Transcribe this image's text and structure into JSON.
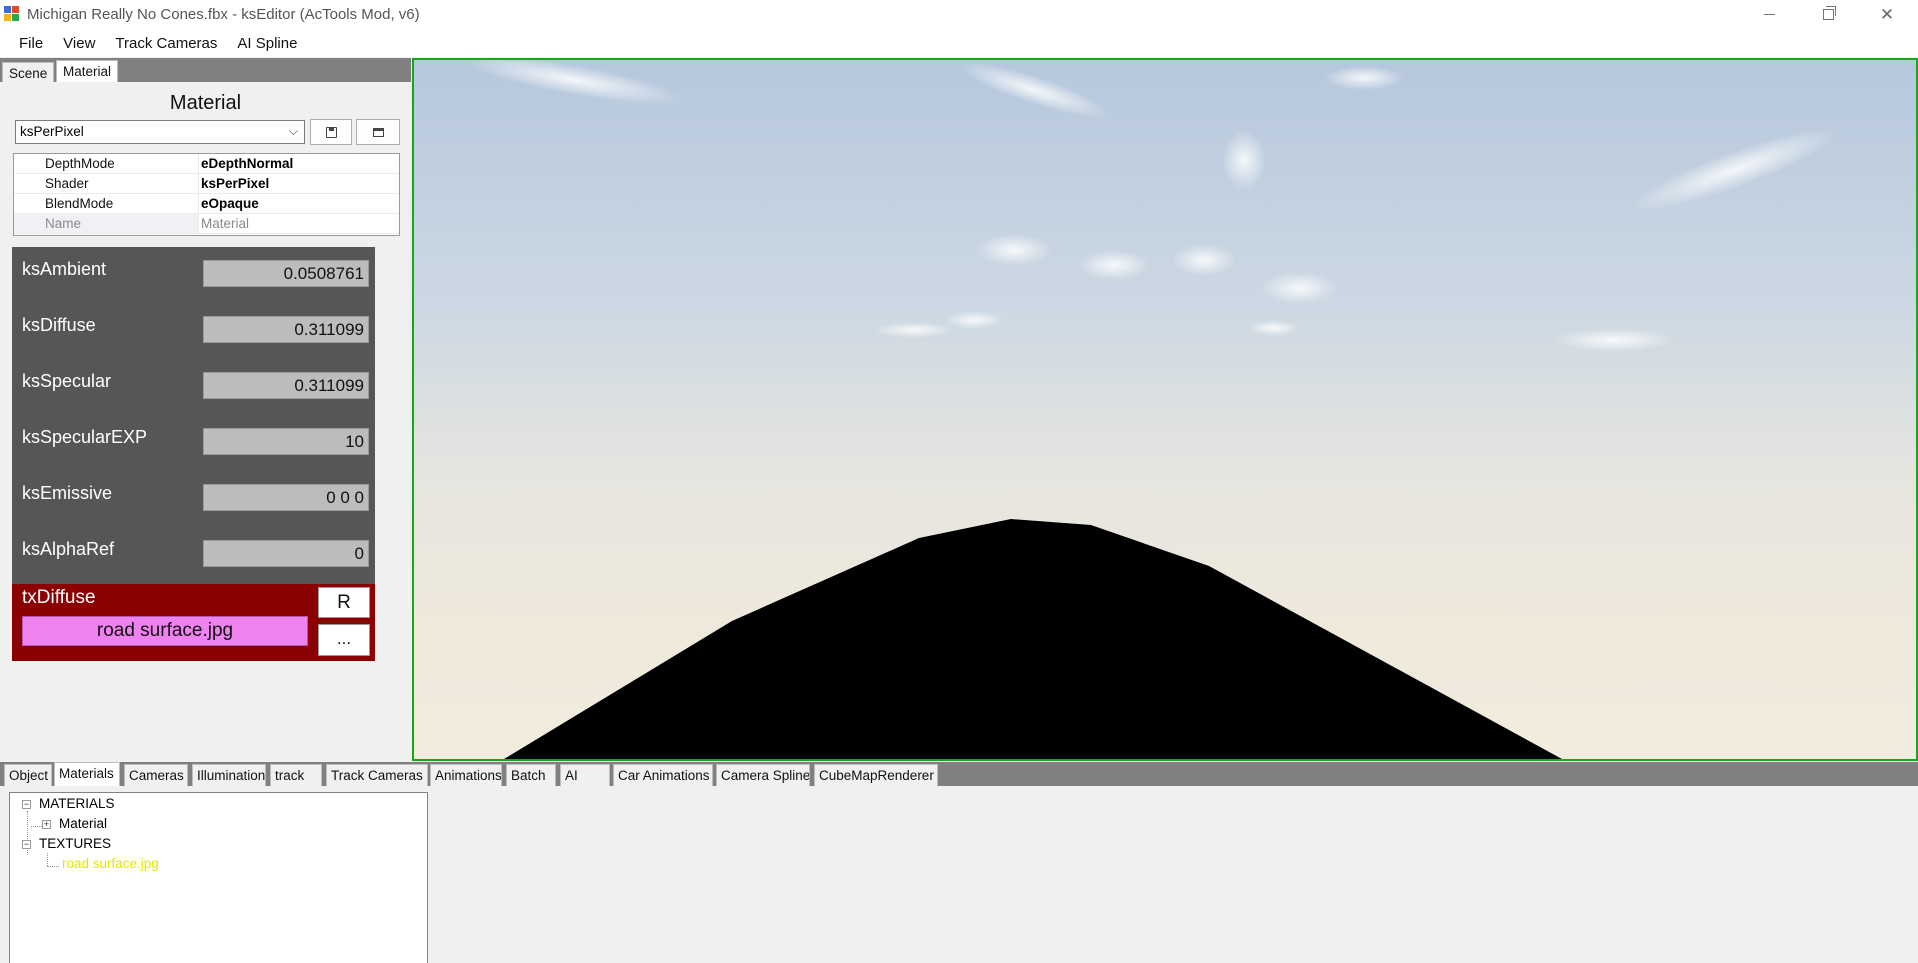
{
  "window": {
    "title": "Michigan Really No Cones.fbx - ksEditor (AcTools Mod, v6)"
  },
  "window_controls": {
    "minimize_icon": "minimize-icon",
    "restore_icon": "restore-icon",
    "close_icon": "close-icon",
    "close_glyph": "✕"
  },
  "menu": {
    "items": [
      "File",
      "View",
      "Track Cameras",
      "AI Spline"
    ]
  },
  "left_tabs": [
    "Scene",
    "Material"
  ],
  "left_active_tab": "Material",
  "material_panel": {
    "heading": "Material",
    "shader_select_value": "ksPerPixel",
    "chevron": "⌵",
    "properties": [
      {
        "name": "DepthMode",
        "value": "eDepthNormal"
      },
      {
        "name": "Shader",
        "value": "ksPerPixel"
      },
      {
        "name": "BlendMode",
        "value": "eOpaque"
      },
      {
        "name": "Name",
        "value": "Material"
      }
    ],
    "parameters": [
      {
        "name": "ksAmbient",
        "value": "0.0508761"
      },
      {
        "name": "ksDiffuse",
        "value": "0.311099"
      },
      {
        "name": "ksSpecular",
        "value": "0.311099"
      },
      {
        "name": "ksSpecularEXP",
        "value": "10"
      },
      {
        "name": "ksEmissive",
        "value": "0 0 0"
      },
      {
        "name": "ksAlphaRef",
        "value": "0"
      }
    ],
    "texture": {
      "label": "txDiffuse",
      "file": "road surface.jpg",
      "reset_label": "R",
      "browse_label": "..."
    }
  },
  "bottom_tabs": [
    "Object",
    "Materials",
    "Cameras",
    "Illumination",
    "track",
    "Track Cameras",
    "Animations",
    "Batch",
    "AI",
    "Car Animations",
    "Camera Spline",
    "CubeMapRenderer"
  ],
  "bottom_active_tab": "Materials",
  "tree": {
    "nodes": [
      {
        "label": "MATERIALS",
        "expander": "−"
      },
      {
        "label": "Material",
        "expander": "+"
      },
      {
        "label": "TEXTURES",
        "expander": "−"
      },
      {
        "label": "road surface.jpg"
      }
    ]
  },
  "colors": {
    "viewport_border": "#16a816",
    "texture_panel": "#8b0000",
    "texture_file_bg": "#ee82ee",
    "params_panel": "#565656",
    "texture_node_text": "#e6e600"
  }
}
